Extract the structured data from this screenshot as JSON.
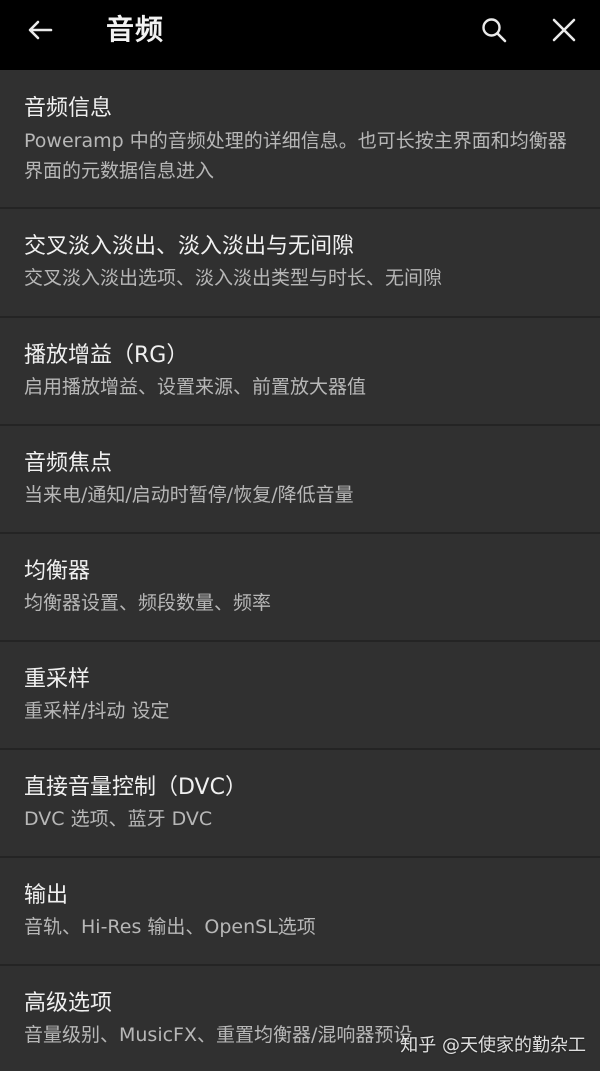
{
  "header": {
    "title": "音频"
  },
  "items": [
    {
      "label": "音频信息",
      "summary": "Poweramp 中的音频处理的详细信息。也可长按主界面和均衡器界面的元数据信息进入"
    },
    {
      "label": "交叉淡入淡出、淡入淡出与无间隙",
      "summary": "交叉淡入淡出选项、淡入淡出类型与时长、无间隙"
    },
    {
      "label": "播放增益（RG）",
      "summary": "启用播放增益、设置来源、前置放大器值"
    },
    {
      "label": "音频焦点",
      "summary": "当来电/通知/启动时暂停/恢复/降低音量"
    },
    {
      "label": "均衡器",
      "summary": "均衡器设置、频段数量、频率"
    },
    {
      "label": "重采样",
      "summary": "重采样/抖动 设定"
    },
    {
      "label": "直接音量控制（DVC）",
      "summary": "DVC 选项、蓝牙 DVC"
    },
    {
      "label": "输出",
      "summary": "音轨、Hi-Res 输出、OpenSL选项"
    },
    {
      "label": "高级选项",
      "summary": "音量级别、MusicFX、重置均衡器/混响器预设"
    }
  ],
  "watermark": "知乎 @天使家的勤杂工"
}
